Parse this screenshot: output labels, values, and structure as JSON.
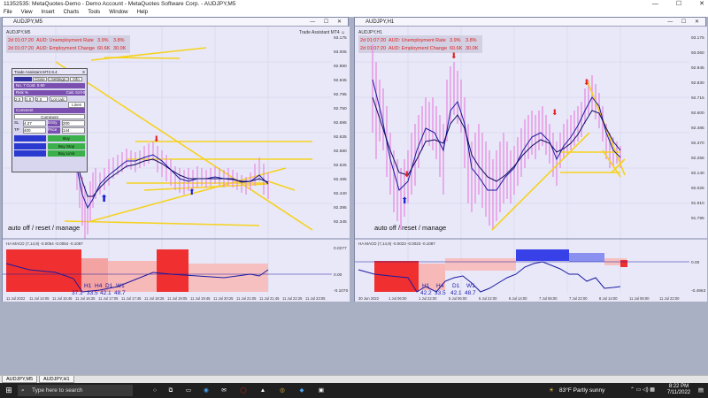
{
  "window": {
    "title": "11352535: MetaQuotes-Demo - Demo Account - MetaQuotes Software Corp. - AUDJPY,M5",
    "minimize": "—",
    "maximize": "☐",
    "close": "✕"
  },
  "menu": [
    "File",
    "View",
    "Insert",
    "Charts",
    "Tools",
    "Window",
    "Help"
  ],
  "left_chart": {
    "title": "AUDJPY,M5",
    "symbol_label": "AUDJPY,M5",
    "ea_label": "Trade Assistant MT4 ☺",
    "news": [
      {
        "time": "2d 01:07:20",
        "event": "AUD: Unemployment Rate",
        "v1": "3.9%",
        "v2": "3.8%"
      },
      {
        "time": "2d 01:07:20",
        "event": "AUD: Employment Change",
        "v1": "60.6K",
        "v2": "30.0K"
      }
    ],
    "assistant": {
      "title": "Trade Assistant MT4 8.4",
      "close_btn": "X",
      "b_close": "Close",
      "b_settings": "| Settings |",
      "b_info": "Info",
      "r1": "No. 7 Cost: 0.60",
      "r2_label": "Risk %",
      "r2_l2": "Calc Sz/Ht",
      "f1": "2.0",
      "f2": "1.0",
      "f3": "2.0",
      "lot_calc": "Lot calc.",
      "lines": "Lines",
      "comment_label": "Comment",
      "comment_btn": "Comment",
      "sl_label": "SL",
      "sl_val": "4.27",
      "entry_label": "Entry",
      "entry_val": "200",
      "tp_label": "TP",
      "tp_val": "400",
      "price_label": "Price",
      "price_val": "144",
      "buy": "Buy",
      "buy_stop": "Buy Stop",
      "buy_limit": "Buy Limit"
    },
    "price_labels": [
      "93.175",
      "93.005",
      "92.890",
      "92.845",
      "92.795",
      "92.750",
      "92.695",
      "92.635",
      "92.580",
      "92.525",
      "92.485",
      "92.440",
      "92.395",
      "92.345"
    ],
    "annotation": "auto off / reset / manage",
    "macd_label": "HA MACD (7,14,9) -0.0054 -0.0054 -0.1087",
    "macd_scale": [
      "0.0277",
      "0.00",
      "-0.1070"
    ],
    "tf_labels": [
      {
        "tf": "H1",
        "val": "37.1"
      },
      {
        "tf": "H4",
        "val": "33.5"
      },
      {
        "tf": "D1",
        "val": "42.1"
      },
      {
        "tf": "W1",
        "val": "48.7"
      }
    ],
    "time_labels": [
      "11 Jul 2022",
      "11 Jul 14:05",
      "11 Jul 15:45",
      "11 Jul 16:25",
      "11 Jul 17:05",
      "11 Jul 17:45",
      "11 Jul 18:25",
      "11 Jul 19:05",
      "11 Jul 19:45",
      "11 Jul 20:25",
      "11 Jul 21:05",
      "11 Jul 21:45",
      "11 Jul 22:25",
      "11 Jul 23:05"
    ]
  },
  "right_chart": {
    "title": "AUDJPY,H1",
    "symbol_label": "AUDJPY,H1",
    "news": [
      {
        "time": "2d 01:07:20",
        "event": "AUD: Unemployment Rate",
        "v1": "3.9%",
        "v2": "3.8%"
      },
      {
        "time": "2d 01:07:20",
        "event": "AUD: Employment Change",
        "v1": "60.6K",
        "v2": "30.0K"
      }
    ],
    "price_labels": [
      "93.175",
      "93.060",
      "92.945",
      "92.830",
      "92.715",
      "92.600",
      "92.485",
      "92.370",
      "92.255",
      "92.140",
      "92.025",
      "91.910",
      "91.795"
    ],
    "annotation": "auto off / reset / manage",
    "macd_label": "HA MACD (7,14,9) -0.0023 -0.0023 -0.1087",
    "macd_scale": [
      "0.00",
      "-0.4963"
    ],
    "tf_labels": [
      {
        "tf": "H1",
        "val": "42.2"
      },
      {
        "tf": "H4",
        "val": "33.5"
      },
      {
        "tf": "D1",
        "val": "42.1"
      },
      {
        "tf": "W1",
        "val": "48.7"
      }
    ],
    "time_labels": [
      "30 Jun 2022",
      "1 Jul 06:00",
      "1 Jul 22:00",
      "5 Jul 06:00",
      "5 Jul 22:00",
      "6 Jul 14:00",
      "7 Jul 06:00",
      "7 Jul 22:00",
      "8 Jul 14:00",
      "11 Jul 06:00",
      "11 Jul 22:00"
    ]
  },
  "tabs": [
    "AUDJPY,M5",
    "AUDJPY,H1"
  ],
  "taskbar": {
    "search_placeholder": "Type here to search",
    "weather": "83°F  Partly sunny",
    "time": "8:22 PM",
    "date": "7/11/2022"
  }
}
